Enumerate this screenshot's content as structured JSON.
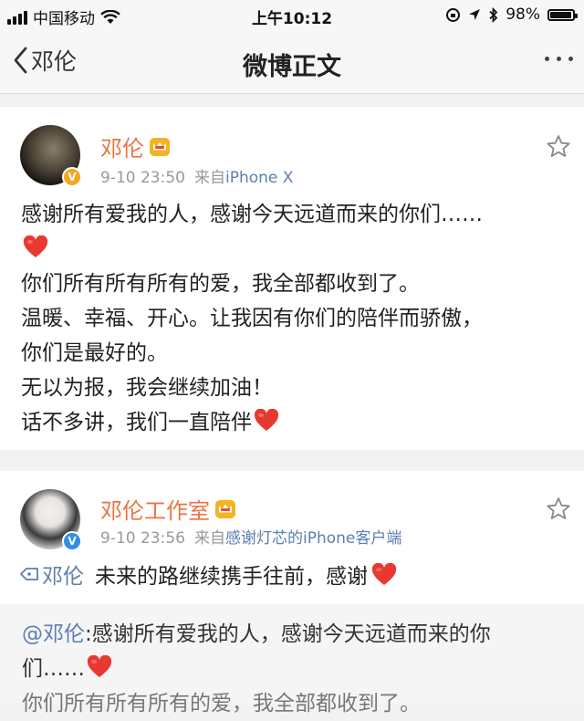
{
  "status_bar": {
    "carrier": "中国移动",
    "time": "上午10:12",
    "battery": "98%",
    "battery_level": 0.98
  },
  "nav": {
    "back_label": "邓伦",
    "title": "微博正文"
  },
  "post": {
    "author": "邓伦",
    "time": "9-10 23:50",
    "source_prefix": "来自",
    "source": "iPhone X",
    "lines": [
      "感谢所有爱我的人，感谢今天远道而来的你们……",
      "你们所有所有所有的爱，我全部都收到了。",
      "温暖、幸福、开心。让我因有你们的陪伴而骄傲，",
      "你们是最好的。",
      "无以为报，我会继续加油！",
      "话不多讲，我们一直陪伴"
    ]
  },
  "repost": {
    "author": "邓伦工作室",
    "time": "9-10 23:56",
    "source_prefix": "来自",
    "source": "感谢灯芯的iPhone客户端",
    "mention": "邓伦",
    "text": "未来的路继续携手往前，感谢",
    "quoted": {
      "at": "@邓伦",
      "line1": ":感谢所有爱我的人，感谢今天远道而来的你",
      "line2": "们……",
      "line3": "你们所有所有所有的爱，我全部都收到了。"
    }
  },
  "colors": {
    "accent_orange": "#eb7340",
    "link_blue": "#5b7fb0",
    "heart_red": "#e8382f"
  }
}
